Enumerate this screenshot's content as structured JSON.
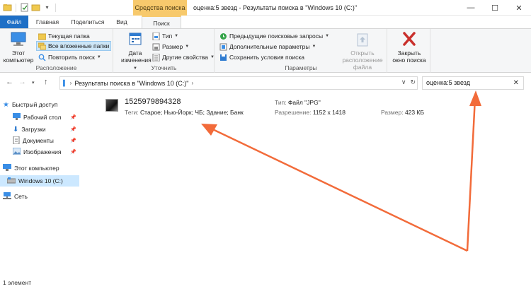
{
  "window": {
    "context_tab": "Средства поиска",
    "title": "оценка:5 звезд - Результаты поиска в \"Windows 10 (C:)\""
  },
  "tabs": [
    "Файл",
    "Главная",
    "Поделиться",
    "Вид",
    "Поиск"
  ],
  "ribbon": {
    "location": {
      "this_pc": "Этот компьютер",
      "current_folder": "Текущая папка",
      "all_subfolders": "Все вложенные папки",
      "search_again": "Повторить поиск",
      "group_label": "Расположение"
    },
    "refine": {
      "date_modified": "Дата изменения",
      "type": "Тип",
      "size": "Размер",
      "other_properties": "Другие свойства",
      "group_label": "Уточнить"
    },
    "options": {
      "recent_searches": "Предыдущие поисковые запросы",
      "advanced_options": "Дополнительные параметры",
      "save_search": "Сохранить условия поиска",
      "open_file_location": "Открыть расположение файла",
      "group_label": "Параметры"
    },
    "close": {
      "label": "Закрыть окно поиска"
    }
  },
  "address": {
    "path": "Результаты поиска в \"Windows 10 (C:)\"",
    "search_value": "оценка:5 звезд"
  },
  "nav": {
    "quick_access": "Быстрый доступ",
    "desktop": "Рабочий стол",
    "downloads": "Загрузки",
    "documents": "Документы",
    "pictures": "Изображения",
    "this_pc": "Этот компьютер",
    "drive_c": "Windows 10 (C:)",
    "network": "Сеть"
  },
  "result": {
    "name": "1525979894328",
    "tags_label": "Теги:",
    "tags": "Старое; Нью-Йорк; ЧБ; Здание; Банк",
    "type_label": "Тип:",
    "type": "Файл \"JPG\"",
    "resolution_label": "Разрешение:",
    "resolution": "1152 x 1418",
    "size_label": "Размер:",
    "size": "423 КБ"
  },
  "status": {
    "count": "1 элемент"
  },
  "colors": {
    "accent": "#1e6fc6",
    "context_tab": "#f7c96c",
    "annotation_arrow": "#f26b3a",
    "selection": "#cce8ff"
  }
}
